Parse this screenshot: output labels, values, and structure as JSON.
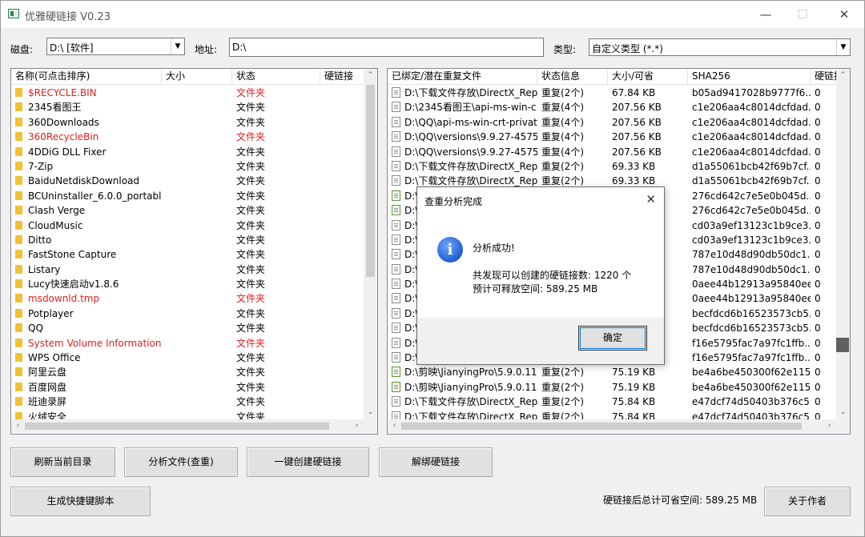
{
  "window": {
    "title": "优雅硬链接 V0.23",
    "min_glyph": "—",
    "max_glyph": "☐",
    "close_glyph": "✕"
  },
  "toolbar": {
    "disk_label": "磁盘:",
    "disk_value": "D:\\ [软件]",
    "address_label": "地址:",
    "address_value": "D:\\",
    "type_label": "类型:",
    "type_value": "自定义类型 (*.*)"
  },
  "left_table": {
    "columns": [
      "名称(可点击排序)",
      "大小",
      "状态",
      "硬链接"
    ],
    "rows": [
      {
        "name": "$RECYCLE.BIN",
        "size": "",
        "status": "文件夹",
        "red": true
      },
      {
        "name": "2345看图王",
        "size": "",
        "status": "文件夹",
        "red": false
      },
      {
        "name": "360Downloads",
        "size": "",
        "status": "文件夹",
        "red": false
      },
      {
        "name": "360RecycleBin",
        "size": "",
        "status": "文件夹",
        "red": true
      },
      {
        "name": "4DDiG DLL Fixer",
        "size": "",
        "status": "文件夹",
        "red": false
      },
      {
        "name": "7-Zip",
        "size": "",
        "status": "文件夹",
        "red": false
      },
      {
        "name": "BaiduNetdiskDownload",
        "size": "",
        "status": "文件夹",
        "red": false
      },
      {
        "name": "BCUninstaller_6.0.0_portable...",
        "size": "",
        "status": "文件夹",
        "red": false
      },
      {
        "name": "Clash Verge",
        "size": "",
        "status": "文件夹",
        "red": false
      },
      {
        "name": "CloudMusic",
        "size": "",
        "status": "文件夹",
        "red": false
      },
      {
        "name": "Ditto",
        "size": "",
        "status": "文件夹",
        "red": false
      },
      {
        "name": "FastStone Capture",
        "size": "",
        "status": "文件夹",
        "red": false
      },
      {
        "name": "Listary",
        "size": "",
        "status": "文件夹",
        "red": false
      },
      {
        "name": "Lucy快速启动v1.8.6",
        "size": "",
        "status": "文件夹",
        "red": false
      },
      {
        "name": "msdownld.tmp",
        "size": "",
        "status": "文件夹",
        "red": true
      },
      {
        "name": "Potplayer",
        "size": "",
        "status": "文件夹",
        "red": false
      },
      {
        "name": "QQ",
        "size": "",
        "status": "文件夹",
        "red": false
      },
      {
        "name": "System Volume Information",
        "size": "",
        "status": "文件夹",
        "red": true
      },
      {
        "name": "WPS Office",
        "size": "",
        "status": "文件夹",
        "red": false
      },
      {
        "name": "阿里云盘",
        "size": "",
        "status": "文件夹",
        "red": false
      },
      {
        "name": "百度网盘",
        "size": "",
        "status": "文件夹",
        "red": false
      },
      {
        "name": "班迪录屏",
        "size": "",
        "status": "文件夹",
        "red": false
      },
      {
        "name": "火绒安全",
        "size": "",
        "status": "文件夹",
        "red": false
      }
    ]
  },
  "right_table": {
    "columns": [
      "已绑定/潜在重复文件",
      "状态信息",
      "大小/可省",
      "SHA256",
      "硬链接"
    ],
    "rows": [
      {
        "path": "D:\\下载文件存放\\DirectX_Rep...",
        "status": "重复(2个)",
        "size": "67.84 KB",
        "sha": "b05ad9417028b9777f6...",
        "links": "0",
        "icon": "plain"
      },
      {
        "path": "D:\\2345看图王\\api-ms-win-c...",
        "status": "重复(4个)",
        "size": "207.56 KB",
        "sha": "c1e206aa4c8014dcfdad...",
        "links": "0",
        "icon": "plain"
      },
      {
        "path": "D:\\QQ\\api-ms-win-crt-privat...",
        "status": "重复(4个)",
        "size": "207.56 KB",
        "sha": "c1e206aa4c8014dcfdad...",
        "links": "0",
        "icon": "plain"
      },
      {
        "path": "D:\\QQ\\versions\\9.9.27-4575...",
        "status": "重复(4个)",
        "size": "207.56 KB",
        "sha": "c1e206aa4c8014dcfdad...",
        "links": "0",
        "icon": "plain"
      },
      {
        "path": "D:\\QQ\\versions\\9.9.27-4575...",
        "status": "重复(4个)",
        "size": "207.56 KB",
        "sha": "c1e206aa4c8014dcfdad...",
        "links": "0",
        "icon": "plain"
      },
      {
        "path": "D:\\下载文件存放\\DirectX_Rep...",
        "status": "重复(2个)",
        "size": "69.33 KB",
        "sha": "d1a55061bcb42f69b7cf...",
        "links": "0",
        "icon": "plain"
      },
      {
        "path": "D:\\下载文件存放\\DirectX_Rep...",
        "status": "重复(2个)",
        "size": "69.33 KB",
        "sha": "d1a55061bcb42f69b7cf...",
        "links": "0",
        "icon": "plain"
      },
      {
        "path": "D:\\",
        "status": "",
        "size": "",
        "sha": "276cd642c7e5e0b045d...",
        "links": "0",
        "icon": "green"
      },
      {
        "path": "D:\\",
        "status": "",
        "size": "",
        "sha": "276cd642c7e5e0b045d...",
        "links": "0",
        "icon": "green"
      },
      {
        "path": "D:\\",
        "status": "",
        "size": "",
        "sha": "cd03a9ef13123c1b9ce3...",
        "links": "0",
        "icon": "plain"
      },
      {
        "path": "D:\\",
        "status": "",
        "size": "",
        "sha": "cd03a9ef13123c1b9ce3...",
        "links": "0",
        "icon": "plain"
      },
      {
        "path": "D:\\",
        "status": "",
        "size": "",
        "sha": "787e10d48d90db50dc1...",
        "links": "0",
        "icon": "plain"
      },
      {
        "path": "D:\\",
        "status": "",
        "size": "",
        "sha": "787e10d48d90db50dc1...",
        "links": "0",
        "icon": "plain"
      },
      {
        "path": "D:\\",
        "status": "",
        "size": "",
        "sha": "0aee44b12913a95840ee...",
        "links": "0",
        "icon": "plain"
      },
      {
        "path": "D:\\",
        "status": "",
        "size": "",
        "sha": "0aee44b12913a95840ee...",
        "links": "0",
        "icon": "plain"
      },
      {
        "path": "D:\\",
        "status": "",
        "size": "",
        "sha": "becfdcd6b16523573cb5...",
        "links": "0",
        "icon": "plain"
      },
      {
        "path": "D:\\",
        "status": "",
        "size": "",
        "sha": "becfdcd6b16523573cb5...",
        "links": "0",
        "icon": "plain"
      },
      {
        "path": "D:\\",
        "status": "",
        "size": "",
        "sha": "f16e5795fac7a97fc1ffb...",
        "links": "0",
        "icon": "plain"
      },
      {
        "path": "D:\\",
        "status": "",
        "size": "",
        "sha": "f16e5795fac7a97fc1ffb...",
        "links": "0",
        "icon": "plain"
      },
      {
        "path": "D:\\剪映\\JianyingPro\\5.9.0.11...",
        "status": "重复(2个)",
        "size": "75.19 KB",
        "sha": "be4a6be450300f62e115...",
        "links": "0",
        "icon": "green"
      },
      {
        "path": "D:\\剪映\\JianyingPro\\5.9.0.11...",
        "status": "重复(2个)",
        "size": "75.19 KB",
        "sha": "be4a6be450300f62e115...",
        "links": "0",
        "icon": "green"
      },
      {
        "path": "D:\\下载文件存放\\DirectX_Rep...",
        "status": "重复(2个)",
        "size": "75.84 KB",
        "sha": "e47dcf74d50403b376c5...",
        "links": "0",
        "icon": "plain"
      },
      {
        "path": "D:\\下载文件存放\\DirectX_Rep...",
        "status": "重复(2个)",
        "size": "75.84 KB",
        "sha": "e47dcf74d50403b376c5...",
        "links": "0",
        "icon": "plain"
      }
    ]
  },
  "buttons": {
    "refresh": "刷新当前目录",
    "analyze": "分析文件(查重)",
    "create_links": "一键创建硬链接",
    "unbind": "解绑硬链接",
    "gen_script": "生成快捷键脚本",
    "about": "关于作者"
  },
  "footer": {
    "total_saved": "硬链接后总计可省空间: 589.25 MB"
  },
  "dialog": {
    "title": "查重分析完成",
    "close_glyph": "✕",
    "icon_glyph": "i",
    "line1": "分析成功!",
    "line2": "共发现可以创建的硬链接数:  1220 个",
    "line3": "预计可释放空间:  589.25 MB",
    "ok": "确定"
  },
  "colors": {
    "red_text": "#e0201c",
    "folder": "#f1c232",
    "accent": "#0078d7"
  }
}
